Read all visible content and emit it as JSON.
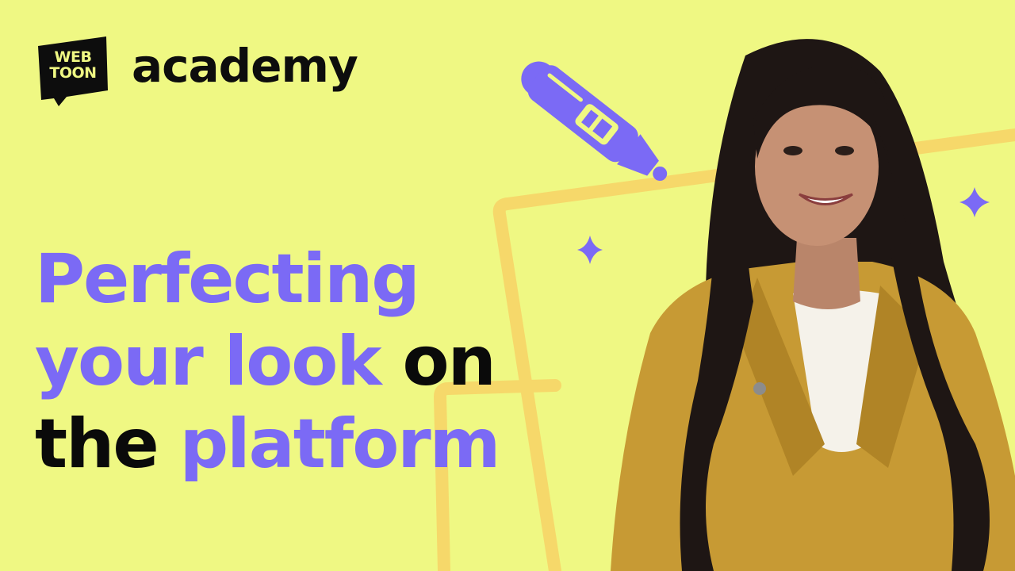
{
  "logo": {
    "badge_line1": "WEB",
    "badge_line2": "TOON",
    "wordmark": "academy"
  },
  "headline": {
    "line1": {
      "accent": "Perfecting"
    },
    "line2": {
      "accent": "your look",
      "dark": "on"
    },
    "line3": {
      "dark": "the",
      "accent": "platform"
    }
  },
  "colors": {
    "background": "#EFF883",
    "accent": "#7B6AF5",
    "text_dark": "#0A0A0A",
    "frame_line": "#F6D86A",
    "jacket": "#C79A34",
    "hair": "#1E1614"
  },
  "icons": [
    "stylus-pen-icon",
    "sparkle-icon",
    "sparkle-icon"
  ]
}
